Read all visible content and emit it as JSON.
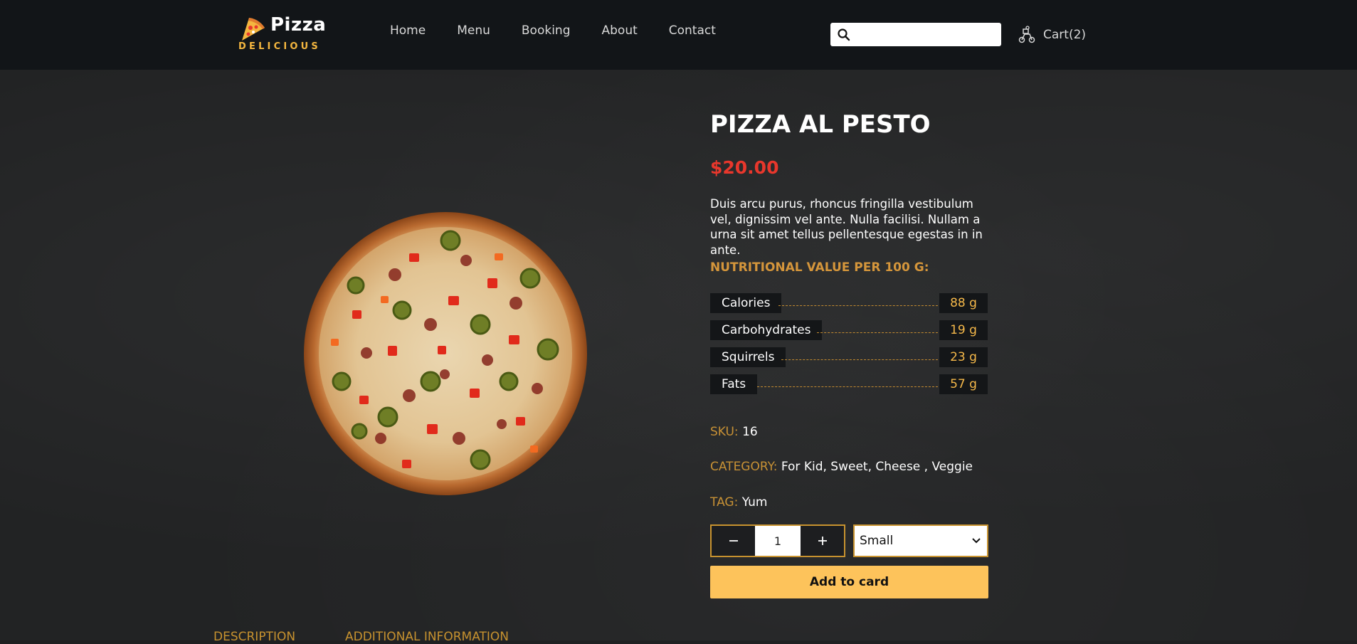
{
  "header": {
    "logo_title": "Pizza",
    "logo_subtitle": "DELICIOUS",
    "nav": [
      {
        "label": "Home"
      },
      {
        "label": "Menu"
      },
      {
        "label": "Booking"
      },
      {
        "label": "About"
      },
      {
        "label": "Contact"
      }
    ],
    "search": {
      "value": "",
      "placeholder": ""
    },
    "cart_label": "Cart(2)"
  },
  "product": {
    "title": "PIZZA AL PESTO",
    "price": "$20.00",
    "description": "Duis arcu purus, rhoncus fringilla vestibulum vel, dignissim vel ante. Nulla facilisi. Nullam a urna sit amet tellus pellentesque egestas in in ante.",
    "nutrition_heading": "NUTRITIONAL VALUE PER 100 G:",
    "nutrition": [
      {
        "name": "Calories",
        "value": "88 g"
      },
      {
        "name": "Carbohydrates",
        "value": "19 g"
      },
      {
        "name": "Squirrels",
        "value": "23 g"
      },
      {
        "name": "Fats",
        "value": "57 g"
      }
    ],
    "sku_label": "SKU:",
    "sku_value": "16",
    "category_label": "CATEGORY:",
    "category_value": "For Kid, Sweet, Cheese , Veggie",
    "tag_label": "TAG:",
    "tag_value": "Yum",
    "quantity": "1",
    "size": "Small",
    "add_button": "Add to card"
  },
  "tabs": [
    {
      "label": "DESCRIPTION"
    },
    {
      "label": "ADDITIONAL INFORMATION"
    }
  ],
  "colors": {
    "accent": "#fdc35b",
    "price": "#e8372c",
    "gold_text": "#c7922f",
    "header_bg": "#121518"
  },
  "icons": [
    "pizza-slice-logo-icon",
    "search-icon",
    "delivery-scooter-icon",
    "minus-icon",
    "plus-icon",
    "chevron-down-icon"
  ]
}
